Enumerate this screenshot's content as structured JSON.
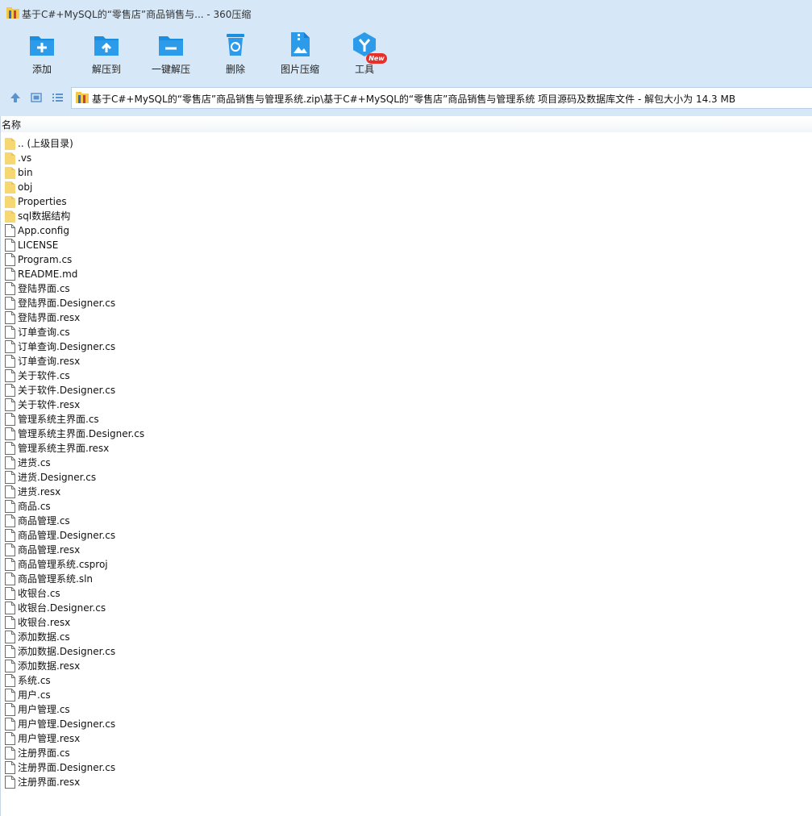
{
  "window": {
    "title": "基于C#+MySQL的“零售店”商品销售与... - 360压缩"
  },
  "toolbar": {
    "items": [
      {
        "label": "添加",
        "icon": "add-folder-icon"
      },
      {
        "label": "解压到",
        "icon": "extract-to-icon"
      },
      {
        "label": "一键解压",
        "icon": "one-click-extract-icon"
      },
      {
        "label": "删除",
        "icon": "recycle-bin-icon"
      },
      {
        "label": "图片压缩",
        "icon": "image-compress-icon"
      },
      {
        "label": "工具",
        "icon": "tools-icon"
      }
    ],
    "new_badge": "New"
  },
  "navigation": {
    "path": "基于C#+MySQL的“零售店”商品销售与管理系统.zip\\基于C#+MySQL的“零售店”商品销售与管理系统 项目源码及数据库文件 - 解包大小为 14.3 MB"
  },
  "file_list": {
    "column_name": "名称",
    "rows": [
      {
        "name": ".. (上级目录)",
        "type": "folder"
      },
      {
        "name": ".vs",
        "type": "folder"
      },
      {
        "name": "bin",
        "type": "folder"
      },
      {
        "name": "obj",
        "type": "folder"
      },
      {
        "name": "Properties",
        "type": "folder"
      },
      {
        "name": "sql数据结构",
        "type": "folder"
      },
      {
        "name": "App.config",
        "type": "file"
      },
      {
        "name": "LICENSE",
        "type": "file"
      },
      {
        "name": "Program.cs",
        "type": "file"
      },
      {
        "name": "README.md",
        "type": "file"
      },
      {
        "name": "登陆界面.cs",
        "type": "file"
      },
      {
        "name": "登陆界面.Designer.cs",
        "type": "file"
      },
      {
        "name": "登陆界面.resx",
        "type": "file"
      },
      {
        "name": "订单查询.cs",
        "type": "file"
      },
      {
        "name": "订单查询.Designer.cs",
        "type": "file"
      },
      {
        "name": "订单查询.resx",
        "type": "file"
      },
      {
        "name": "关于软件.cs",
        "type": "file"
      },
      {
        "name": "关于软件.Designer.cs",
        "type": "file"
      },
      {
        "name": "关于软件.resx",
        "type": "file"
      },
      {
        "name": "管理系统主界面.cs",
        "type": "file"
      },
      {
        "name": "管理系统主界面.Designer.cs",
        "type": "file"
      },
      {
        "name": "管理系统主界面.resx",
        "type": "file"
      },
      {
        "name": "进货.cs",
        "type": "file"
      },
      {
        "name": "进货.Designer.cs",
        "type": "file"
      },
      {
        "name": "进货.resx",
        "type": "file"
      },
      {
        "name": "商品.cs",
        "type": "file"
      },
      {
        "name": "商品管理.cs",
        "type": "file"
      },
      {
        "name": "商品管理.Designer.cs",
        "type": "file"
      },
      {
        "name": "商品管理.resx",
        "type": "file"
      },
      {
        "name": "商品管理系统.csproj",
        "type": "file"
      },
      {
        "name": "商品管理系统.sln",
        "type": "file"
      },
      {
        "name": "收银台.cs",
        "type": "file"
      },
      {
        "name": "收银台.Designer.cs",
        "type": "file"
      },
      {
        "name": "收银台.resx",
        "type": "file"
      },
      {
        "name": "添加数据.cs",
        "type": "file"
      },
      {
        "name": "添加数据.Designer.cs",
        "type": "file"
      },
      {
        "name": "添加数据.resx",
        "type": "file"
      },
      {
        "name": "系统.cs",
        "type": "file"
      },
      {
        "name": "用户.cs",
        "type": "file"
      },
      {
        "name": "用户管理.cs",
        "type": "file"
      },
      {
        "name": "用户管理.Designer.cs",
        "type": "file"
      },
      {
        "name": "用户管理.resx",
        "type": "file"
      },
      {
        "name": "注册界面.cs",
        "type": "file"
      },
      {
        "name": "注册界面.Designer.cs",
        "type": "file"
      },
      {
        "name": "注册界面.resx",
        "type": "file"
      }
    ]
  },
  "colors": {
    "toolbar_bg": "#d6e8f8",
    "icon_blue": "#1a8fe0",
    "folder_yellow": "#f6d873",
    "badge_red": "#e8302a"
  }
}
